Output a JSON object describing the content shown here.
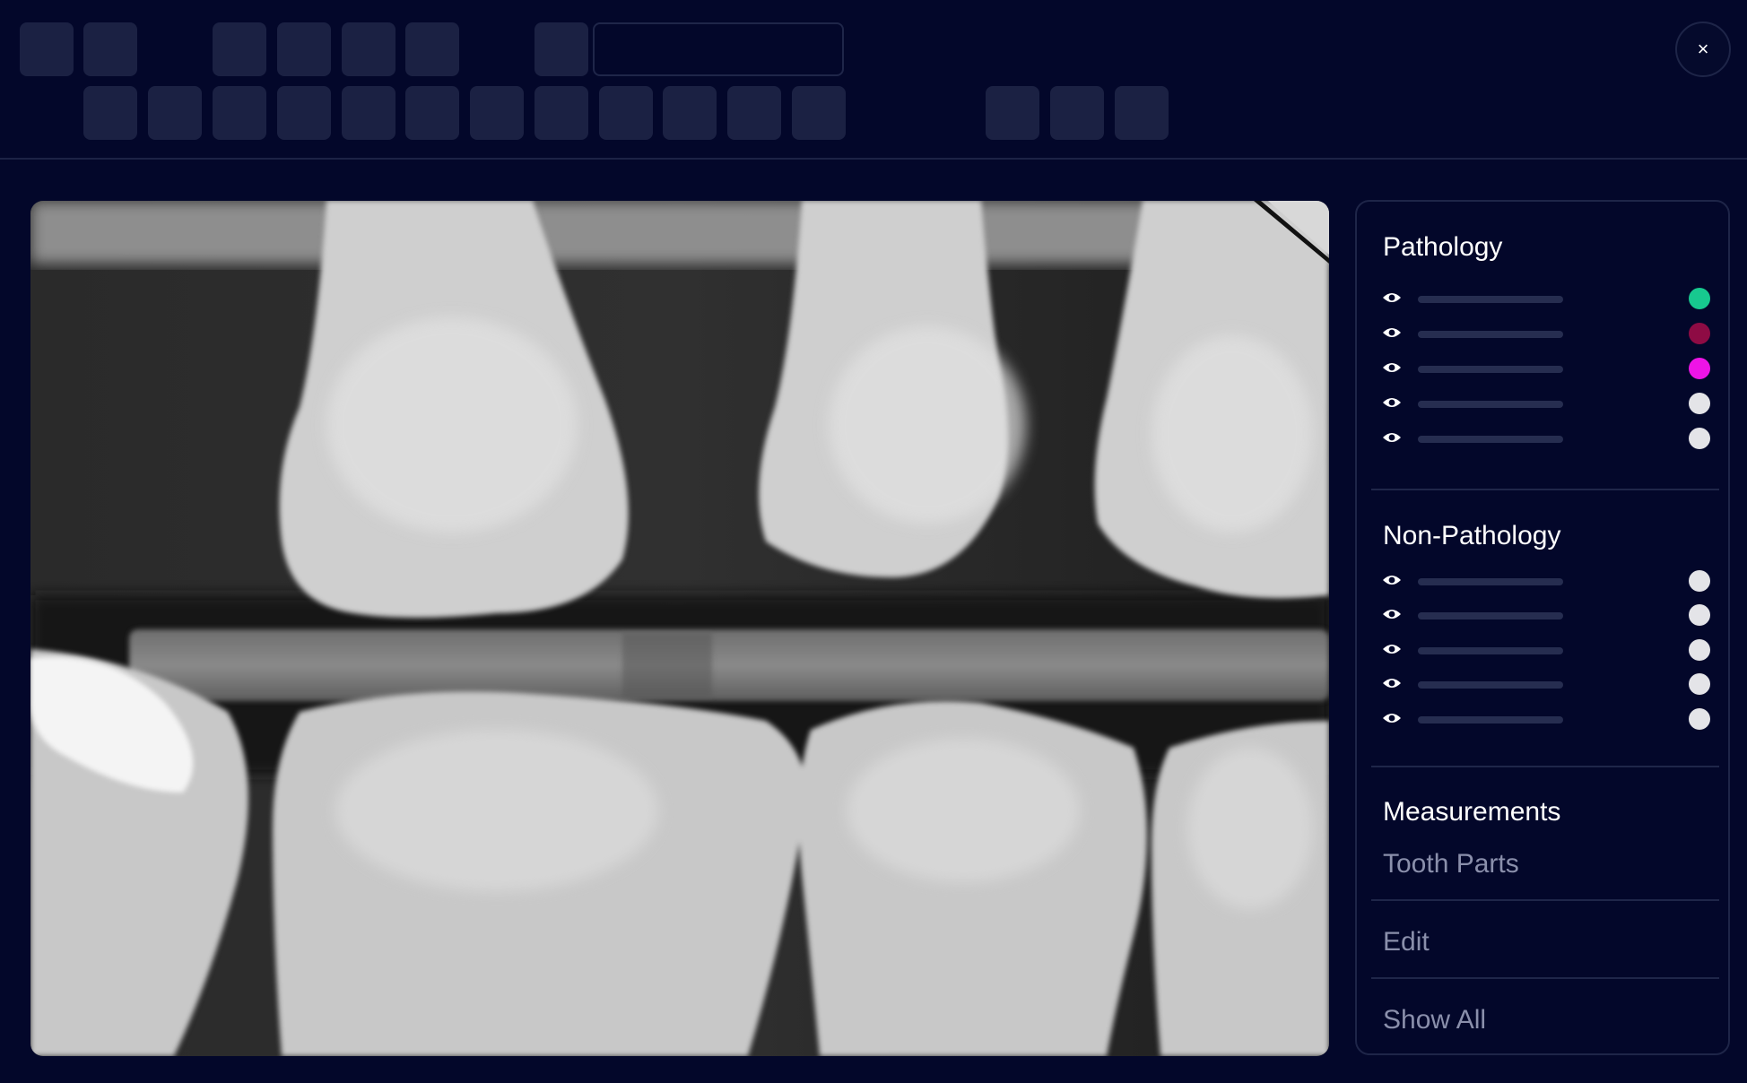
{
  "window": {
    "close_symbol": "×"
  },
  "icons": {
    "close": "close-icon",
    "eye": "eye-icon"
  },
  "panel": {
    "pathology": {
      "title": "Pathology",
      "items": [
        {
          "color": "#17c98f"
        },
        {
          "color": "#8e0b44"
        },
        {
          "color": "#ee14e6"
        },
        {
          "color": "#e4e4e8"
        },
        {
          "color": "#e4e4e8"
        }
      ]
    },
    "non_pathology": {
      "title": "Non-Pathology",
      "items": [
        {
          "color": "#e4e4e8"
        },
        {
          "color": "#e4e4e8"
        },
        {
          "color": "#e4e4e8"
        },
        {
          "color": "#e4e4e8"
        },
        {
          "color": "#e4e4e8"
        }
      ]
    },
    "measurements_label": "Measurements",
    "tooth_parts_label": "Tooth Parts",
    "edit_label": "Edit",
    "show_all_label": "Show All"
  }
}
